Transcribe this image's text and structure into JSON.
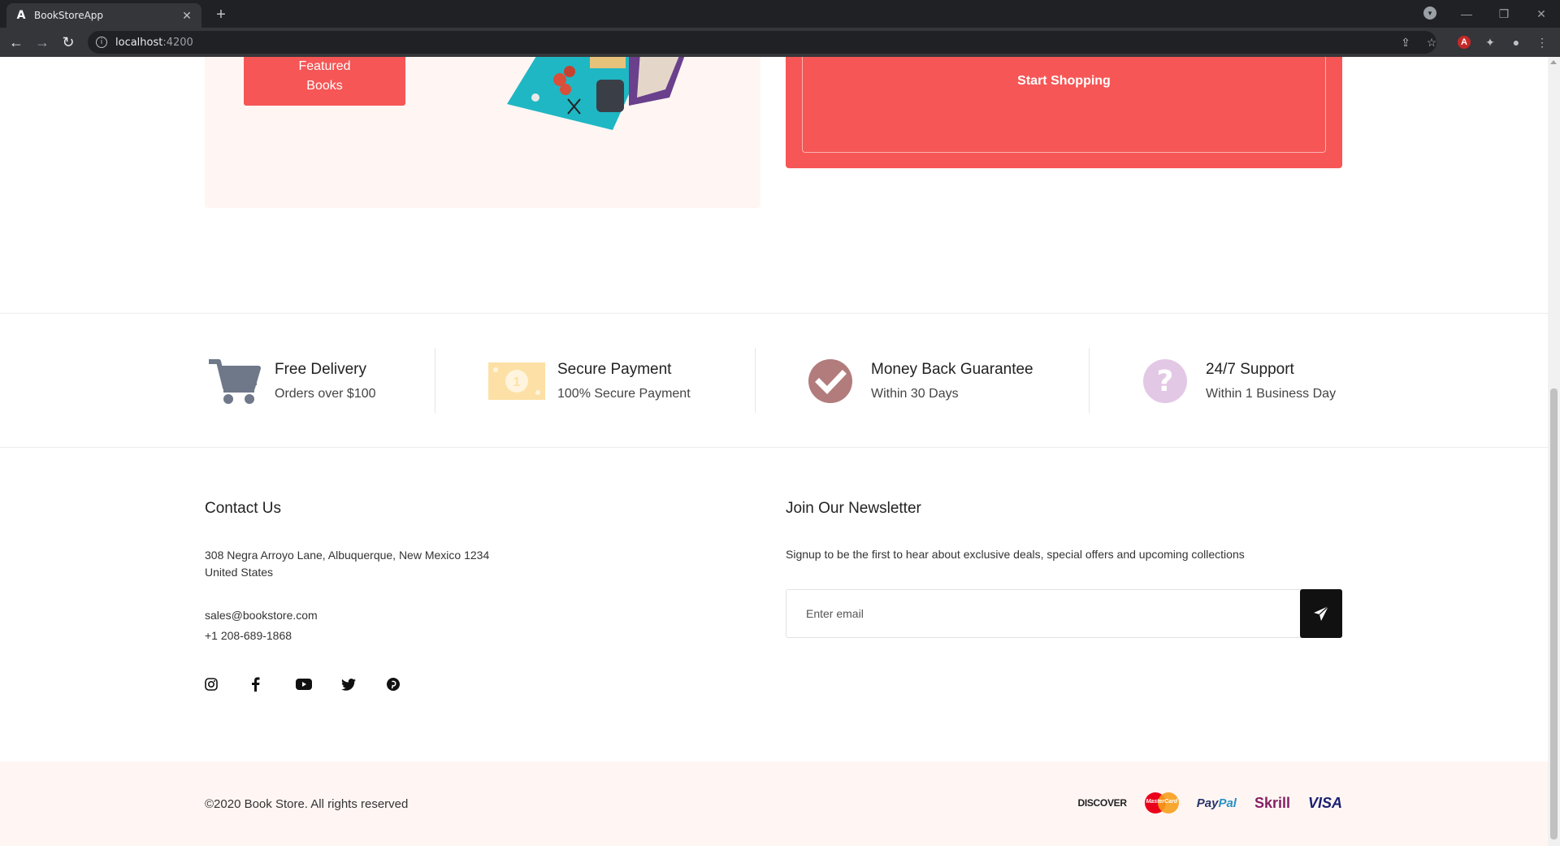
{
  "browser": {
    "tab_title": "BookStoreApp",
    "tab_favicon": "A",
    "url_host": "localhost",
    "url_port": ":4200"
  },
  "promo": {
    "featured_line1": "Featured",
    "featured_line2": "Books",
    "start_shopping": "Start Shopping"
  },
  "features": [
    {
      "icon": "cart-icon",
      "title": "Free Delivery",
      "subtitle": "Orders over $100"
    },
    {
      "icon": "money-icon",
      "title": "Secure Payment",
      "subtitle": "100% Secure Payment"
    },
    {
      "icon": "check-circle-icon",
      "title": "Money Back Guarantee",
      "subtitle": "Within 30 Days"
    },
    {
      "icon": "question-circle-icon",
      "title": "24/7 Support",
      "subtitle": "Within 1 Business Day"
    }
  ],
  "contact": {
    "title": "Contact Us",
    "address_line1": "308 Negra Arroyo Lane, Albuquerque, New Mexico 1234",
    "address_line2": "United States",
    "email": "sales@bookstore.com",
    "phone": "+1 208-689-1868",
    "socials": [
      "instagram-icon",
      "facebook-icon",
      "youtube-icon",
      "twitter-icon",
      "pinterest-icon"
    ]
  },
  "newsletter": {
    "title": "Join Our Newsletter",
    "subtitle": "Signup to be the first to hear about exclusive deals, special offers and upcoming collections",
    "placeholder": "Enter email"
  },
  "footer": {
    "copyright": "©2020 Book Store. All rights reserved",
    "payments": {
      "discover": "DISCOVER",
      "mastercard": "MasterCard",
      "paypal_a": "Pay",
      "paypal_b": "Pal",
      "skrill": "Skrill",
      "visa": "VISA"
    }
  },
  "colors": {
    "accent": "#f65656",
    "promo_bg": "#fff6f4",
    "cart_icon": "#6e7889",
    "money_icon": "#fde0a6",
    "check_icon": "#b27c7c",
    "question_icon": "#e3c8e6"
  }
}
